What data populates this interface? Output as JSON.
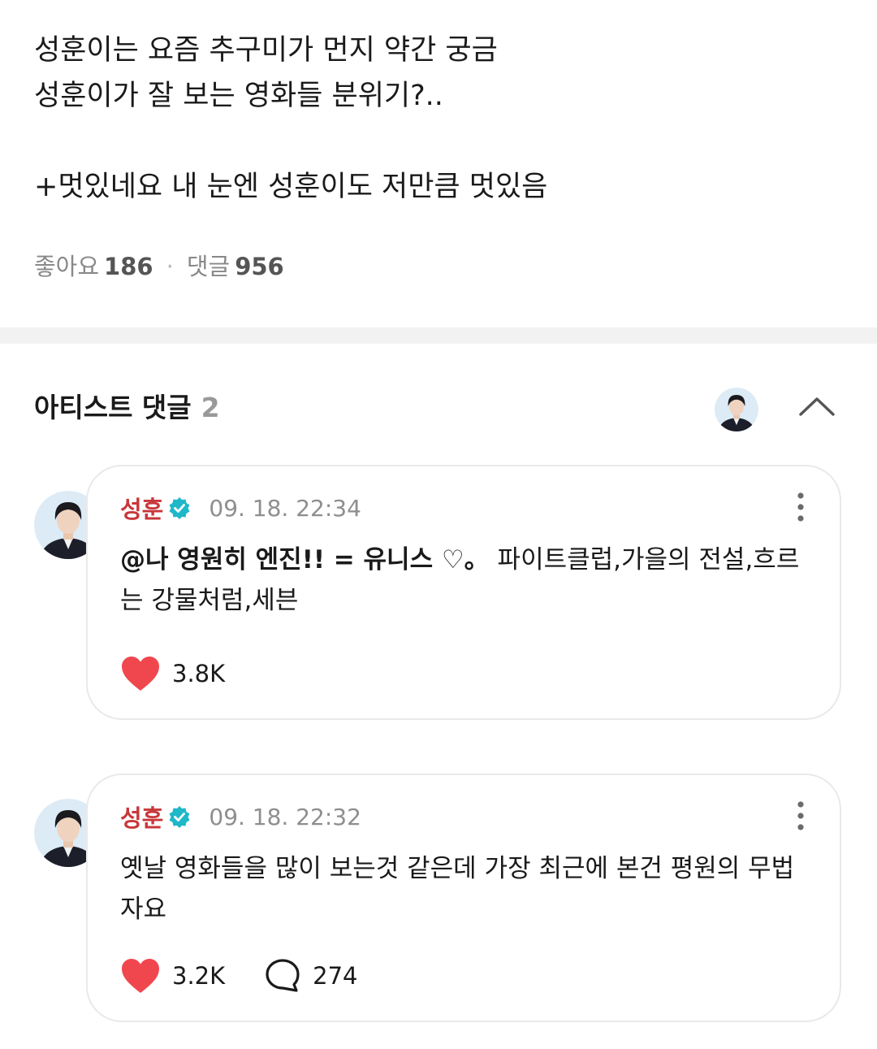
{
  "post": {
    "lines": [
      "성훈이는 요즘 추구미가 먼지 약간 궁금",
      "성훈이가 잘 보는 영화들 분위기?..",
      "",
      "+멋있네요 내 눈엔 성훈이도 저만큼 멋있음"
    ],
    "likes_label": "좋아요",
    "likes_count": "186",
    "comments_label": "댓글",
    "comments_count": "956",
    "separator": "·"
  },
  "artist_comments": {
    "title": "아티스트 댓글",
    "count": "2",
    "collapse_icon": "chevron-up-icon"
  },
  "comments": [
    {
      "author": "성훈",
      "verified_icon": "verified-badge-icon",
      "time": "09. 18. 22:34",
      "mention": "@나 영원히 엔진!! = 유니스 ♡。",
      "text": "파이트클럽,가을의 전설,흐르는 강물처럼,세븐",
      "likes": "3.8K"
    },
    {
      "author": "성훈",
      "verified_icon": "verified-badge-icon",
      "time": "09. 18. 22:32",
      "text": "옛날 영화들을 많이 보는것 같은데 가장 최근에 본건 평원의 무법자요",
      "likes": "3.2K",
      "replies": "274"
    }
  ],
  "colors": {
    "author": "#c8373a",
    "heart": "#f0474f",
    "verified": "#1fb8c9",
    "muted": "#8e8e8e",
    "divider": "#f2f2f2"
  }
}
